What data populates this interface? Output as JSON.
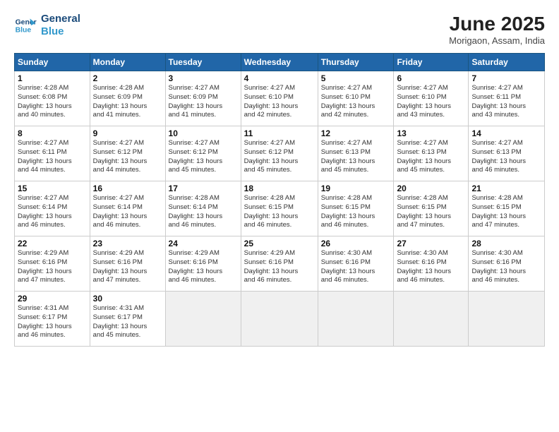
{
  "logo": {
    "line1": "General",
    "line2": "Blue"
  },
  "title": "June 2025",
  "location": "Morigaon, Assam, India",
  "days_of_week": [
    "Sunday",
    "Monday",
    "Tuesday",
    "Wednesday",
    "Thursday",
    "Friday",
    "Saturday"
  ],
  "weeks": [
    [
      {
        "day": "1",
        "info": "Sunrise: 4:28 AM\nSunset: 6:08 PM\nDaylight: 13 hours\nand 40 minutes."
      },
      {
        "day": "2",
        "info": "Sunrise: 4:28 AM\nSunset: 6:09 PM\nDaylight: 13 hours\nand 41 minutes."
      },
      {
        "day": "3",
        "info": "Sunrise: 4:27 AM\nSunset: 6:09 PM\nDaylight: 13 hours\nand 41 minutes."
      },
      {
        "day": "4",
        "info": "Sunrise: 4:27 AM\nSunset: 6:10 PM\nDaylight: 13 hours\nand 42 minutes."
      },
      {
        "day": "5",
        "info": "Sunrise: 4:27 AM\nSunset: 6:10 PM\nDaylight: 13 hours\nand 42 minutes."
      },
      {
        "day": "6",
        "info": "Sunrise: 4:27 AM\nSunset: 6:10 PM\nDaylight: 13 hours\nand 43 minutes."
      },
      {
        "day": "7",
        "info": "Sunrise: 4:27 AM\nSunset: 6:11 PM\nDaylight: 13 hours\nand 43 minutes."
      }
    ],
    [
      {
        "day": "8",
        "info": "Sunrise: 4:27 AM\nSunset: 6:11 PM\nDaylight: 13 hours\nand 44 minutes."
      },
      {
        "day": "9",
        "info": "Sunrise: 4:27 AM\nSunset: 6:12 PM\nDaylight: 13 hours\nand 44 minutes."
      },
      {
        "day": "10",
        "info": "Sunrise: 4:27 AM\nSunset: 6:12 PM\nDaylight: 13 hours\nand 45 minutes."
      },
      {
        "day": "11",
        "info": "Sunrise: 4:27 AM\nSunset: 6:12 PM\nDaylight: 13 hours\nand 45 minutes."
      },
      {
        "day": "12",
        "info": "Sunrise: 4:27 AM\nSunset: 6:13 PM\nDaylight: 13 hours\nand 45 minutes."
      },
      {
        "day": "13",
        "info": "Sunrise: 4:27 AM\nSunset: 6:13 PM\nDaylight: 13 hours\nand 45 minutes."
      },
      {
        "day": "14",
        "info": "Sunrise: 4:27 AM\nSunset: 6:13 PM\nDaylight: 13 hours\nand 46 minutes."
      }
    ],
    [
      {
        "day": "15",
        "info": "Sunrise: 4:27 AM\nSunset: 6:14 PM\nDaylight: 13 hours\nand 46 minutes."
      },
      {
        "day": "16",
        "info": "Sunrise: 4:27 AM\nSunset: 6:14 PM\nDaylight: 13 hours\nand 46 minutes."
      },
      {
        "day": "17",
        "info": "Sunrise: 4:28 AM\nSunset: 6:14 PM\nDaylight: 13 hours\nand 46 minutes."
      },
      {
        "day": "18",
        "info": "Sunrise: 4:28 AM\nSunset: 6:15 PM\nDaylight: 13 hours\nand 46 minutes."
      },
      {
        "day": "19",
        "info": "Sunrise: 4:28 AM\nSunset: 6:15 PM\nDaylight: 13 hours\nand 46 minutes."
      },
      {
        "day": "20",
        "info": "Sunrise: 4:28 AM\nSunset: 6:15 PM\nDaylight: 13 hours\nand 47 minutes."
      },
      {
        "day": "21",
        "info": "Sunrise: 4:28 AM\nSunset: 6:15 PM\nDaylight: 13 hours\nand 47 minutes."
      }
    ],
    [
      {
        "day": "22",
        "info": "Sunrise: 4:29 AM\nSunset: 6:16 PM\nDaylight: 13 hours\nand 47 minutes."
      },
      {
        "day": "23",
        "info": "Sunrise: 4:29 AM\nSunset: 6:16 PM\nDaylight: 13 hours\nand 47 minutes."
      },
      {
        "day": "24",
        "info": "Sunrise: 4:29 AM\nSunset: 6:16 PM\nDaylight: 13 hours\nand 46 minutes."
      },
      {
        "day": "25",
        "info": "Sunrise: 4:29 AM\nSunset: 6:16 PM\nDaylight: 13 hours\nand 46 minutes."
      },
      {
        "day": "26",
        "info": "Sunrise: 4:30 AM\nSunset: 6:16 PM\nDaylight: 13 hours\nand 46 minutes."
      },
      {
        "day": "27",
        "info": "Sunrise: 4:30 AM\nSunset: 6:16 PM\nDaylight: 13 hours\nand 46 minutes."
      },
      {
        "day": "28",
        "info": "Sunrise: 4:30 AM\nSunset: 6:16 PM\nDaylight: 13 hours\nand 46 minutes."
      }
    ],
    [
      {
        "day": "29",
        "info": "Sunrise: 4:31 AM\nSunset: 6:17 PM\nDaylight: 13 hours\nand 46 minutes."
      },
      {
        "day": "30",
        "info": "Sunrise: 4:31 AM\nSunset: 6:17 PM\nDaylight: 13 hours\nand 45 minutes."
      },
      {
        "day": "",
        "info": ""
      },
      {
        "day": "",
        "info": ""
      },
      {
        "day": "",
        "info": ""
      },
      {
        "day": "",
        "info": ""
      },
      {
        "day": "",
        "info": ""
      }
    ]
  ]
}
